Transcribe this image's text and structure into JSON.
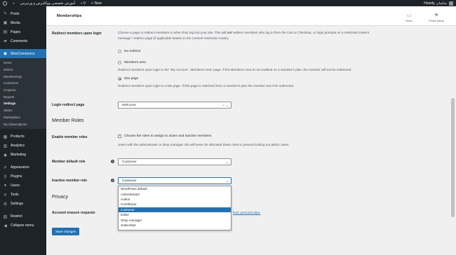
{
  "adminbar": {
    "site_name": "آموزش تخصصی ووکامرس و وردپرس",
    "comments_count": "0",
    "new_label": "New",
    "howdy": "Howdy, ساسان"
  },
  "sidebar": {
    "top_items": [
      {
        "label": "Posts",
        "icon": "pin-icon"
      },
      {
        "label": "Media",
        "icon": "media-icon"
      },
      {
        "label": "Pages",
        "icon": "page-icon"
      },
      {
        "label": "Comments",
        "icon": "comment-icon"
      }
    ],
    "woocommerce_label": "WooCommerce",
    "submenu": [
      "Home",
      "Orders",
      "Memberships",
      "Customers",
      "Coupons",
      "Reports",
      "Settings",
      "Status",
      "Marketplace",
      "My Subscriptions"
    ],
    "current_submenu": "Settings",
    "bottom_items": [
      {
        "label": "Products",
        "icon": "products-icon"
      },
      {
        "label": "Analytics",
        "icon": "analytics-icon"
      },
      {
        "label": "Marketing",
        "icon": "marketing-icon"
      },
      {
        "label": "Appearance",
        "icon": "appearance-icon"
      },
      {
        "label": "Plugins",
        "icon": "plugins-icon"
      },
      {
        "label": "Users",
        "icon": "users-icon"
      },
      {
        "label": "Tools",
        "icon": "tools-icon"
      },
      {
        "label": "Settings",
        "icon": "settings-icon"
      },
      {
        "label": "Restrict",
        "icon": "restrict-icon"
      },
      {
        "label": "Collapse menu",
        "icon": "collapse-icon"
      }
    ]
  },
  "topbar": {
    "title": "Memberships",
    "inbox_label": "Inbox",
    "finish_setup_label": "Finish setup"
  },
  "redirect": {
    "label": "Redirect members upon login",
    "description_line1_a": "Choose a page to redirect members to when they log into your site. This will ",
    "description_line1_not": "not",
    "description_line1_b": " redirect members who log in from the Cart or Checkout, or login prompts on a restricted content",
    "description_line2": "message / redirect page (if applicable based on the Content restriction mode).",
    "options": [
      {
        "label": "No redirect",
        "checked": false,
        "note": ""
      },
      {
        "label": "Members area",
        "checked": false,
        "note": "Redirect members upon login to the \"My Account - Members Area\" page. If the Members Area is not enabled on a member's plan, the member will not be redirected."
      },
      {
        "label": "Site page",
        "checked": true,
        "note": "Redirect members upon login to a site page. If this page is restricted from a member's plan the member won't be redirected."
      }
    ]
  },
  "login_redirect_page": {
    "label": "Login redirect page",
    "value": "Welcome",
    "clear_symbol": "×"
  },
  "member_roles": {
    "section_title": "Member Roles",
    "enable_label": "Enable member roles",
    "enable_checkbox_text": "Choose the roles to assign to active and inactive members.",
    "enable_note": "Users with the administrator or shop manager role will never be allocated these roles to prevent locking out admin users.",
    "enabled": true,
    "default_role_label": "Member default role",
    "default_role_value": "Customer",
    "inactive_role_label": "Inactive member role",
    "inactive_role_value": "Customer",
    "dropdown_options": [
      "WordPress default",
      "Administrator",
      "Author",
      "Contributor",
      "Customer",
      "Editor",
      "Shop manager",
      "Subscriber"
    ],
    "highlighted_option": "Customer"
  },
  "privacy": {
    "section_title": "Privacy",
    "erasure_label": "Account erasure requests",
    "erasure_link_text": "their personal data."
  },
  "save_button": "Save changes"
}
